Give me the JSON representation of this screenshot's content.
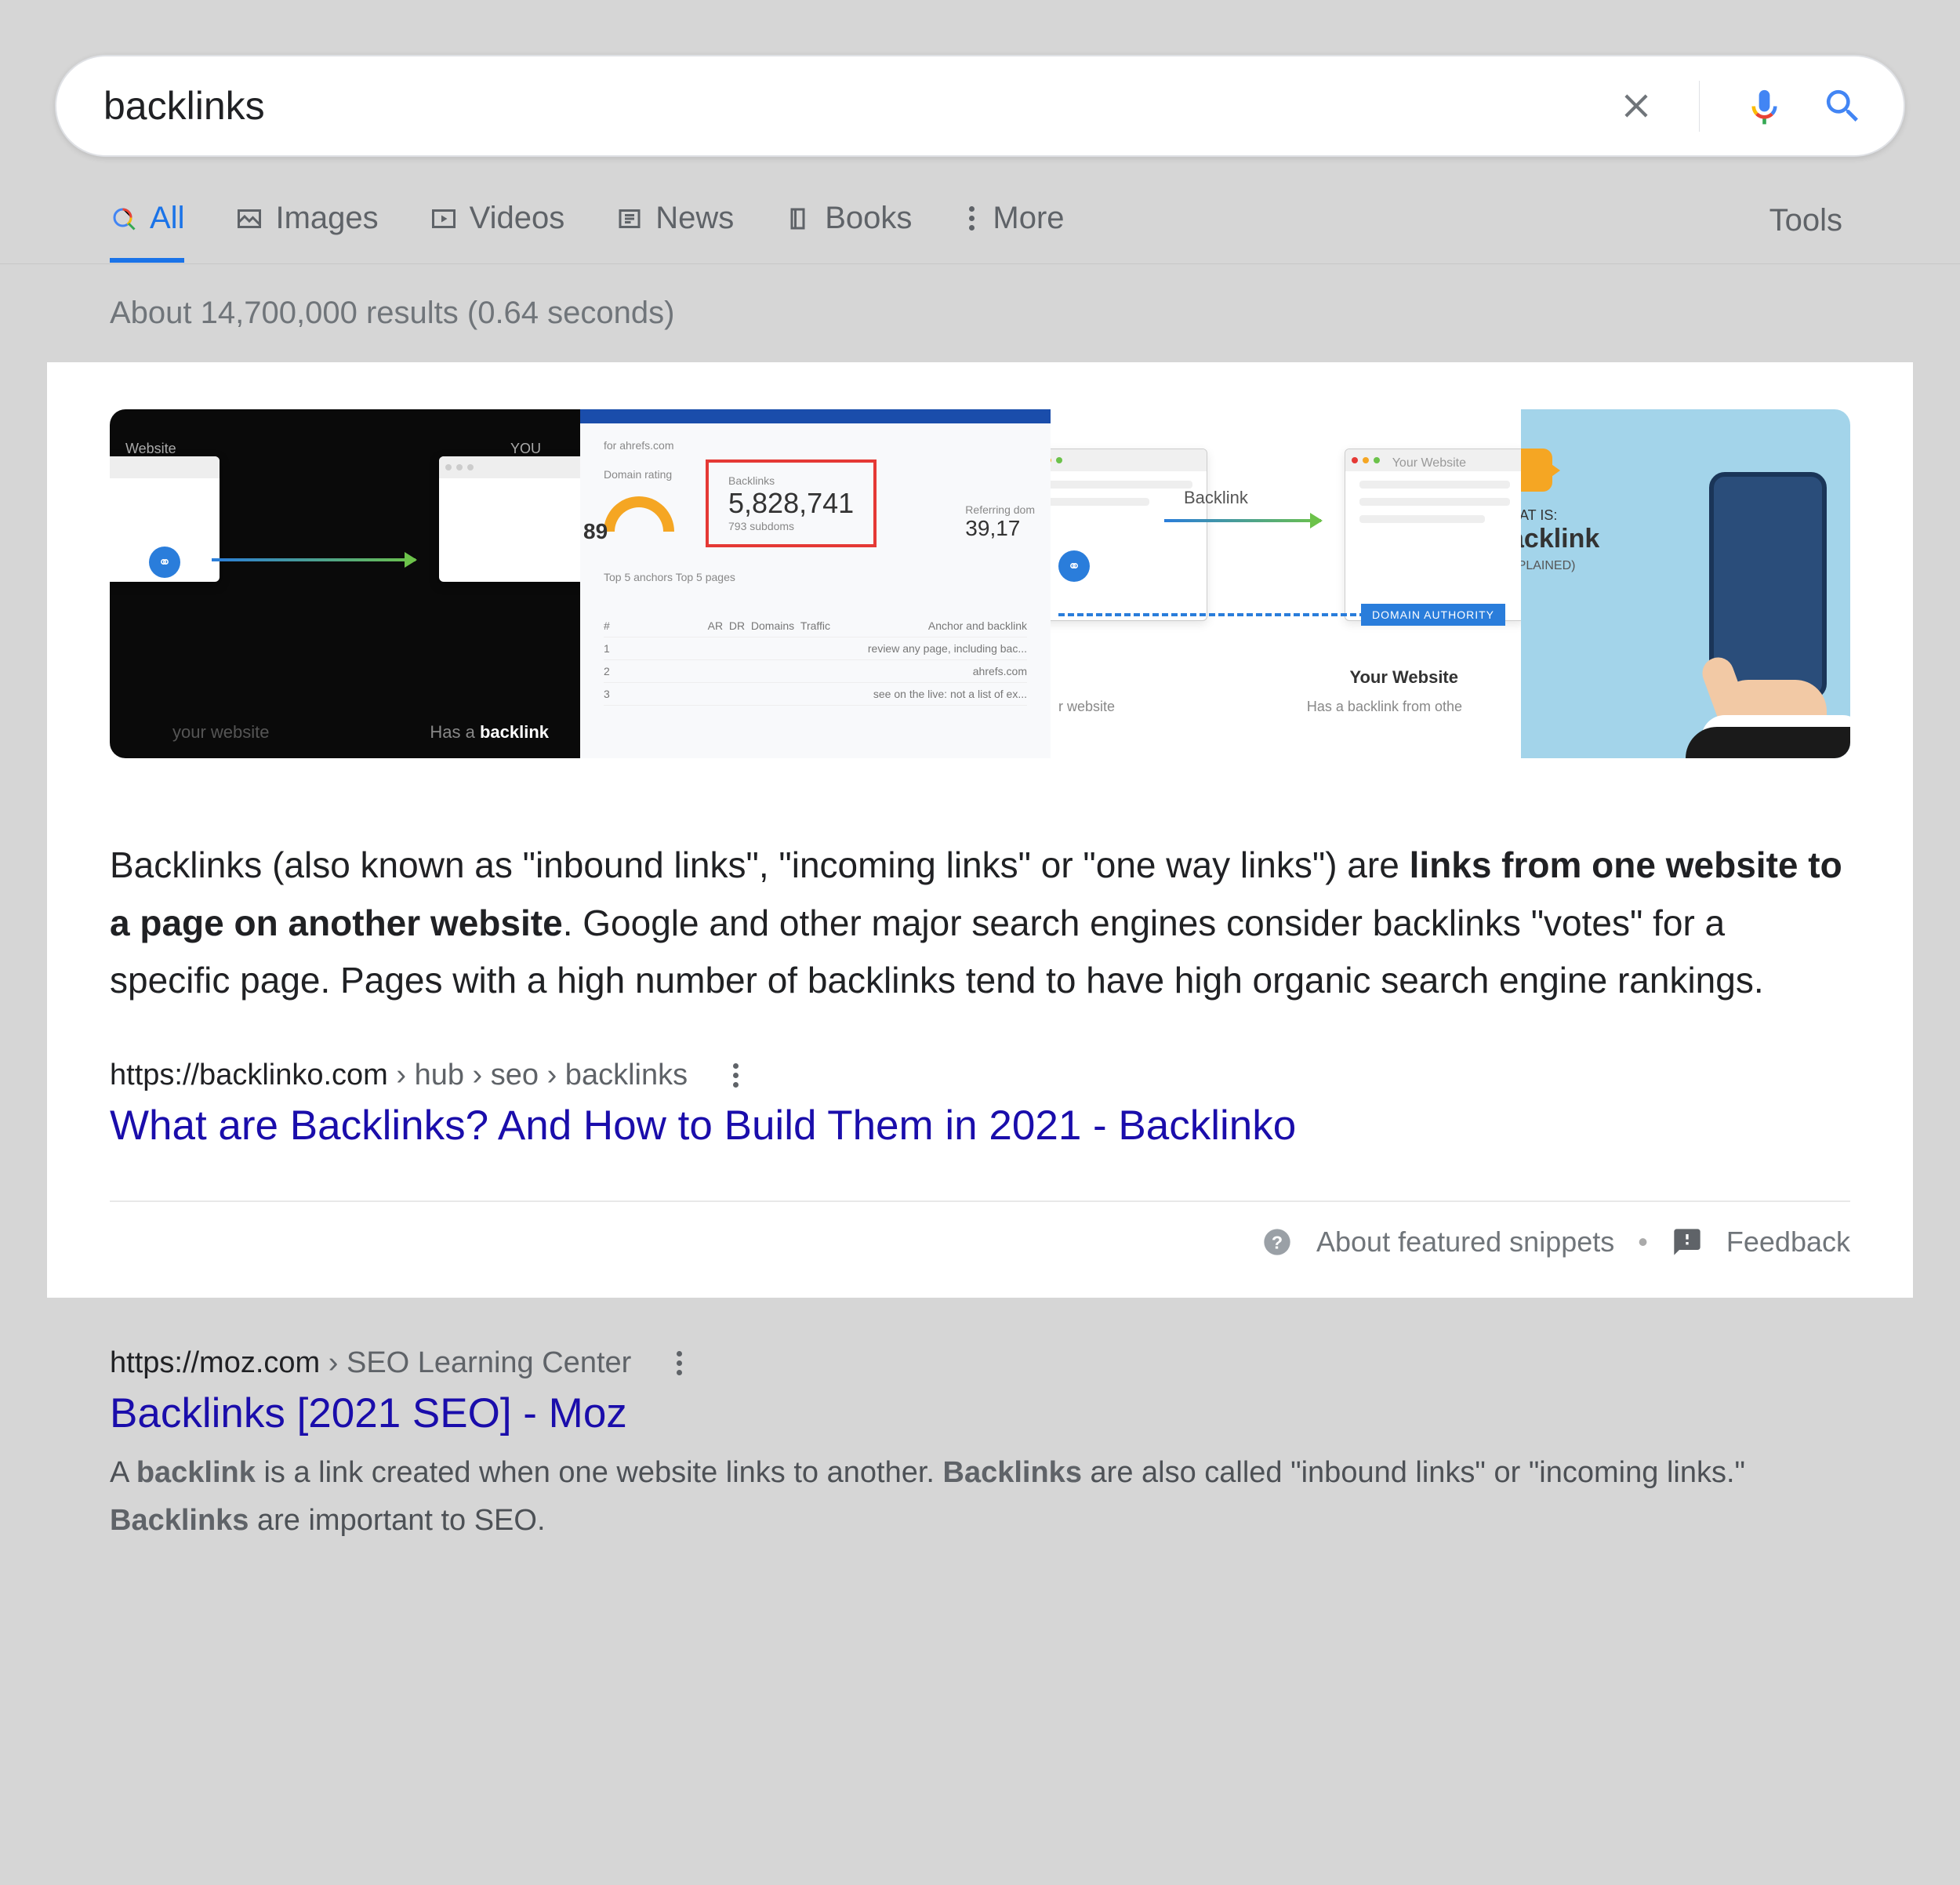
{
  "search": {
    "query": "backlinks"
  },
  "tabs": {
    "all": "All",
    "images": "Images",
    "videos": "Videos",
    "news": "News",
    "books": "Books",
    "more": "More",
    "tools": "Tools"
  },
  "stats": "About 14,700,000 results (0.64 seconds)",
  "thumbs": {
    "img1": {
      "label_left": "Website",
      "label_right": "YOU",
      "caption_left": "your website",
      "caption_right_pre": "Has a ",
      "caption_right_bold": "backlink"
    },
    "img2": {
      "header": "for ahrefs.com",
      "rating_label": "Domain rating",
      "rating": "89",
      "backlinks_label": "Backlinks",
      "backlinks": "5,828,741",
      "subcount": "793 subdoms",
      "refdom_label": "Referring dom",
      "refdom": "39,17",
      "filters": "Top 5 anchors   Top 5 pages"
    },
    "img3": {
      "link_label": "Backlink",
      "badge": "DOMAIN AUTHORITY",
      "your_website": "Your Website",
      "has": "Has a backlink from othe",
      "toplabel": "Your Website",
      "bottomleft": "r website"
    },
    "img4": {
      "line1": "HAT IS:",
      "line2": "acklink",
      "line3": "XPLAINED)"
    }
  },
  "snippet": {
    "p1": "Backlinks (also known as \"inbound links\", \"incoming links\" or \"one way links\") are ",
    "bold": "links from one website to a page on another website",
    "p2": ". Google and other major search engines consider backlinks \"votes\" for a specific page. Pages with a high number of backlinks tend to have high organic search engine rankings."
  },
  "featured": {
    "domain": "https://backlinko.com",
    "path": " › hub › seo › backlinks",
    "title": "What are Backlinks? And How to Build Them in 2021 - Backlinko",
    "about": "About featured snippets",
    "feedback": "Feedback"
  },
  "result2": {
    "domain": "https://moz.com",
    "path": " › SEO Learning Center",
    "title": "Backlinks [2021 SEO] - Moz",
    "desc_pre": "A ",
    "desc_b1": "backlink",
    "desc_mid1": " is a link created when one website links to another. ",
    "desc_b2": "Backlinks",
    "desc_mid2": " are also called \"inbound links\" or \"incoming links.\" ",
    "desc_b3": "Backlinks",
    "desc_end": " are important to SEO."
  }
}
